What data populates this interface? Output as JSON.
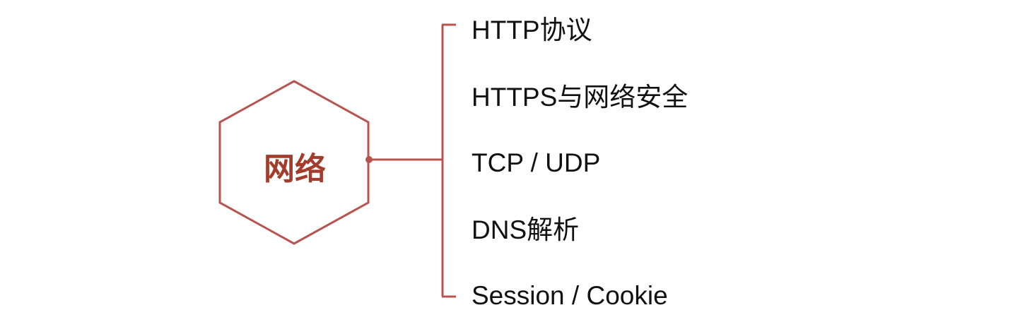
{
  "center_node": {
    "label": "网络"
  },
  "branches": [
    {
      "label": "HTTP协议"
    },
    {
      "label": "HTTPS与网络安全"
    },
    {
      "label": "TCP / UDP"
    },
    {
      "label": "DNS解析"
    },
    {
      "label": "Session / Cookie"
    }
  ],
  "colors": {
    "accent": "#b85450",
    "text": "#111111",
    "background": "#ffffff"
  }
}
